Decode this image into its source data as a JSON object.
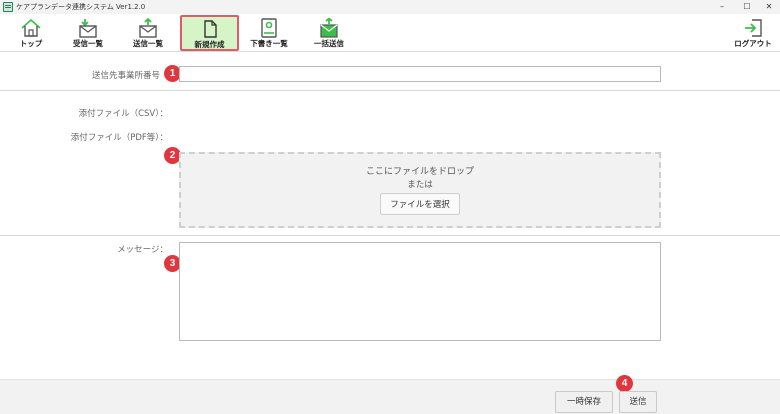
{
  "window": {
    "title": "ケアプランデータ連携システム Ver1.2.0",
    "controls": {
      "minimize": "–",
      "maximize": "☐",
      "close": "✕"
    }
  },
  "toolbar": {
    "items": [
      {
        "label": "トップ",
        "icon": "house-icon"
      },
      {
        "label": "受信一覧",
        "icon": "envelope-inbox-icon"
      },
      {
        "label": "送信一覧",
        "icon": "envelope-outbox-icon"
      },
      {
        "label": "新規作成",
        "icon": "new-document-icon",
        "active": true
      },
      {
        "label": "下書き一覧",
        "icon": "draft-list-icon"
      },
      {
        "label": "一括送信",
        "icon": "bulk-send-icon"
      }
    ],
    "logout": {
      "label": "ログアウト",
      "icon": "logout-icon"
    }
  },
  "form": {
    "destination_label": "送信先事業所番号",
    "destination_value": "",
    "attach_csv_label": "添付ファイル（CSV）：",
    "attach_pdf_label": "添付ファイル（PDF等）：",
    "dropzone": {
      "text": "ここにファイルをドロップ",
      "or_text": "または",
      "select_button": "ファイルを選択"
    },
    "message_label": "メッセージ：",
    "message_value": ""
  },
  "footer": {
    "save_button": "一時保存",
    "send_button": "送信"
  },
  "badges": [
    "1",
    "2",
    "3",
    "4"
  ],
  "colors": {
    "accent_green": "#3cbf4a",
    "active_tab_bg": "#d6f5c7",
    "active_tab_border": "#e05a6b",
    "badge_red": "#e0363d"
  }
}
